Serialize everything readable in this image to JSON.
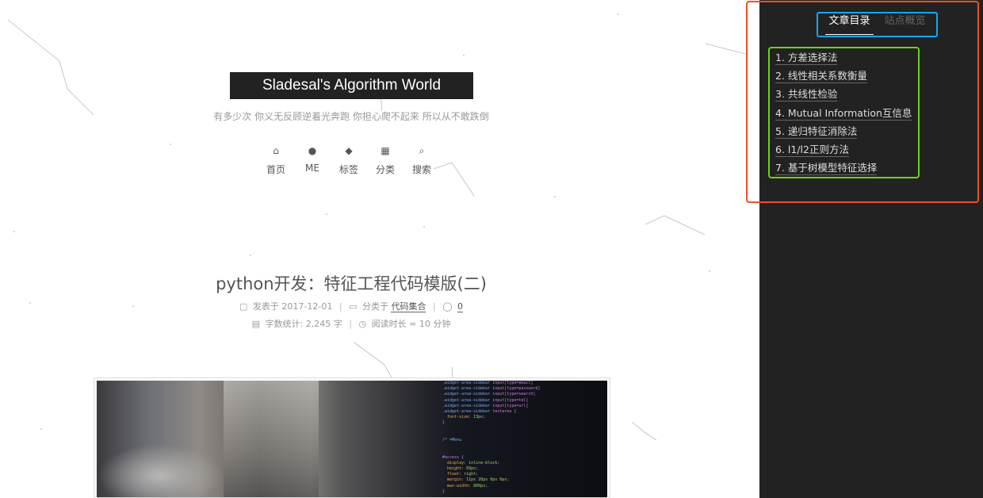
{
  "site": {
    "title": "Sladesal's Algorithm World",
    "subtitle": "有多少次 你义无反顾逆着光奔跑 你担心爬不起来 所以从不敢跌倒"
  },
  "nav": [
    {
      "icon": "home-icon",
      "glyph": "⌂",
      "label": "首页"
    },
    {
      "icon": "user-icon",
      "glyph": "●",
      "label": "ME"
    },
    {
      "icon": "tags-icon",
      "glyph": "◆",
      "label": "标签"
    },
    {
      "icon": "grid-icon",
      "glyph": "▦",
      "label": "分类"
    },
    {
      "icon": "search-icon",
      "glyph": "⌕",
      "label": "搜索"
    }
  ],
  "post": {
    "title": "python开发：特征工程代码模版(二)",
    "posted_label": "发表于",
    "posted_date": "2017-12-01",
    "category_label": "分类于",
    "category": "代码集合",
    "comments": "0",
    "wordcount_label": "字数统计:",
    "wordcount": "2,245 字",
    "readtime_label": "阅读时长 ≈",
    "readtime": "10 分钟"
  },
  "sidebar": {
    "tabs": [
      {
        "label": "文章目录",
        "active": true
      },
      {
        "label": "站点概览",
        "active": false
      }
    ],
    "toc": [
      "1. 方差选择法",
      "2. 线性相关系数衡量",
      "3. 共线性检验",
      "4. Mutual Information互信息",
      "5. 递归特征消除法",
      "6. l1/l2正则方法",
      "7. 基于树模型特征选择"
    ]
  },
  "colors": {
    "sidebar_bg": "#222222",
    "outline_sidebar": "#f04e23",
    "outline_tabs": "#13a8f0",
    "outline_toc": "#68d615"
  }
}
